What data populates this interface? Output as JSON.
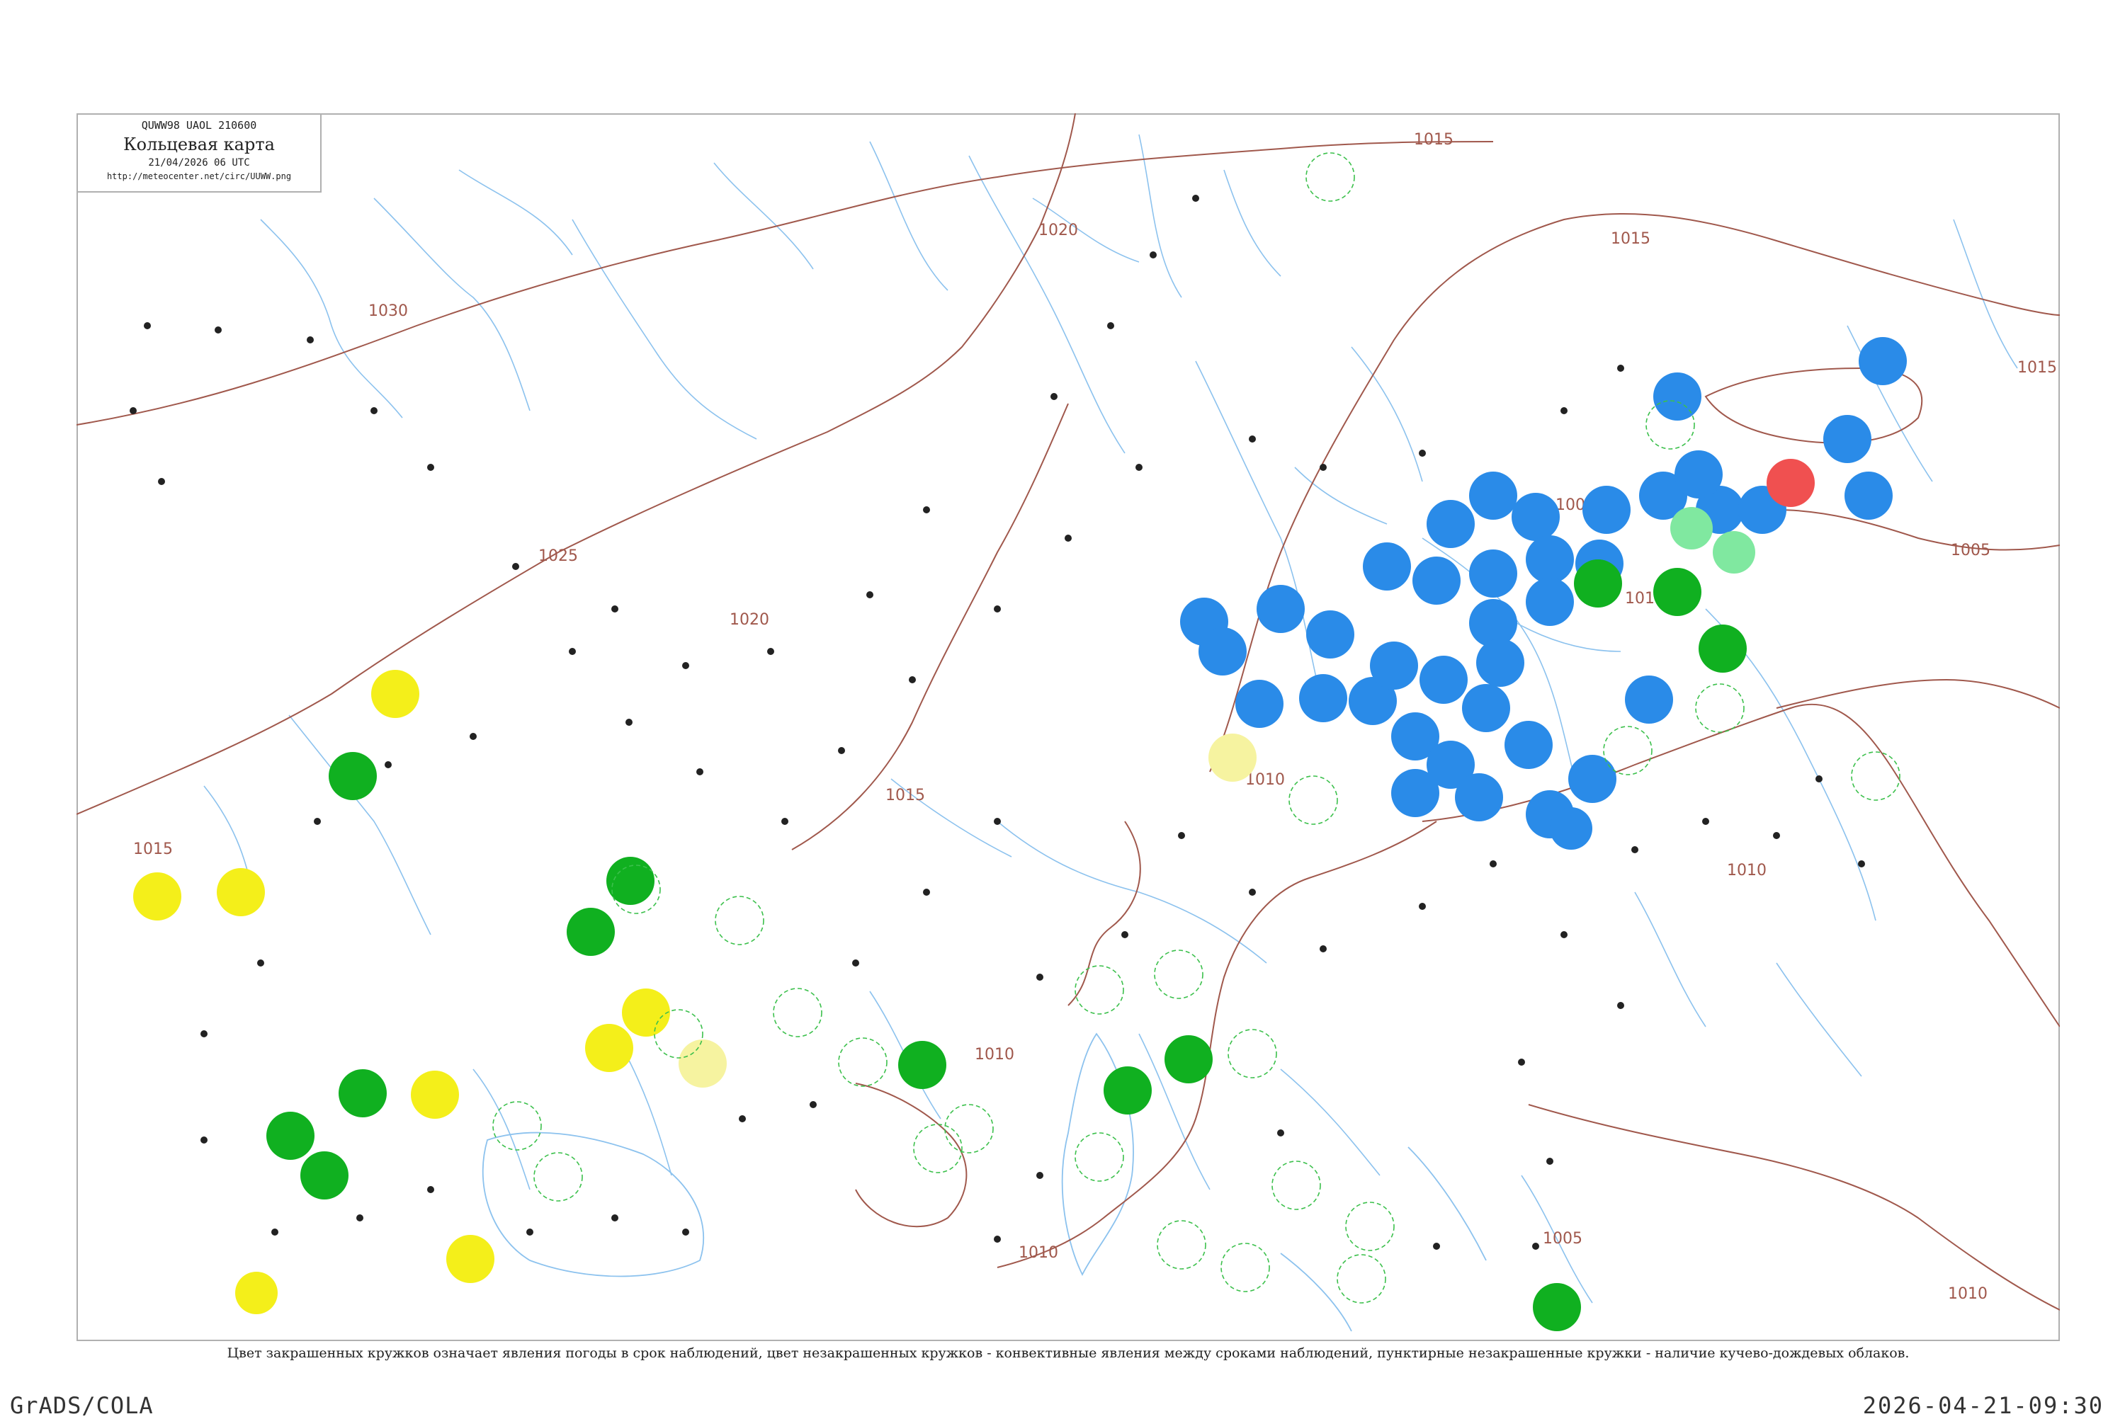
{
  "header": {
    "code": "QUWW98  UAOL  210600",
    "title": "Кольцевая карта",
    "datetime": "21/04/2026 06 UTC",
    "url": "http://meteocenter.net/circ/UUWW.png"
  },
  "caption": "Цвет закрашенных кружков означает явления погоды в срок наблюдений, цвет незакрашенных кружков - конвективные явления между сроками наблюдений, пунктирные незакрашенные кружки - наличие кучево-дождевых облаков.",
  "footer": {
    "left": "GrADS/COLA",
    "right": "2026-04-21-09:30"
  },
  "isobar_labels": [
    "1030",
    "1025",
    "1020",
    "1020",
    "1015",
    "1015",
    "1015",
    "1015",
    "1015",
    "1010",
    "1010",
    "1010",
    "1010",
    "1005",
    "1000",
    "1010",
    "1005",
    "1000",
    "1010"
  ],
  "colors": {
    "isobar": "#a0584c",
    "river": "#7fb8e8",
    "frame": "#b0b0b0",
    "blue_circle": "#2a8be8",
    "green_circle": "#10b020",
    "yellow_circle": "#f4ef1a",
    "red_circle": "#f05050",
    "light_green_circle": "#80e8a0"
  }
}
